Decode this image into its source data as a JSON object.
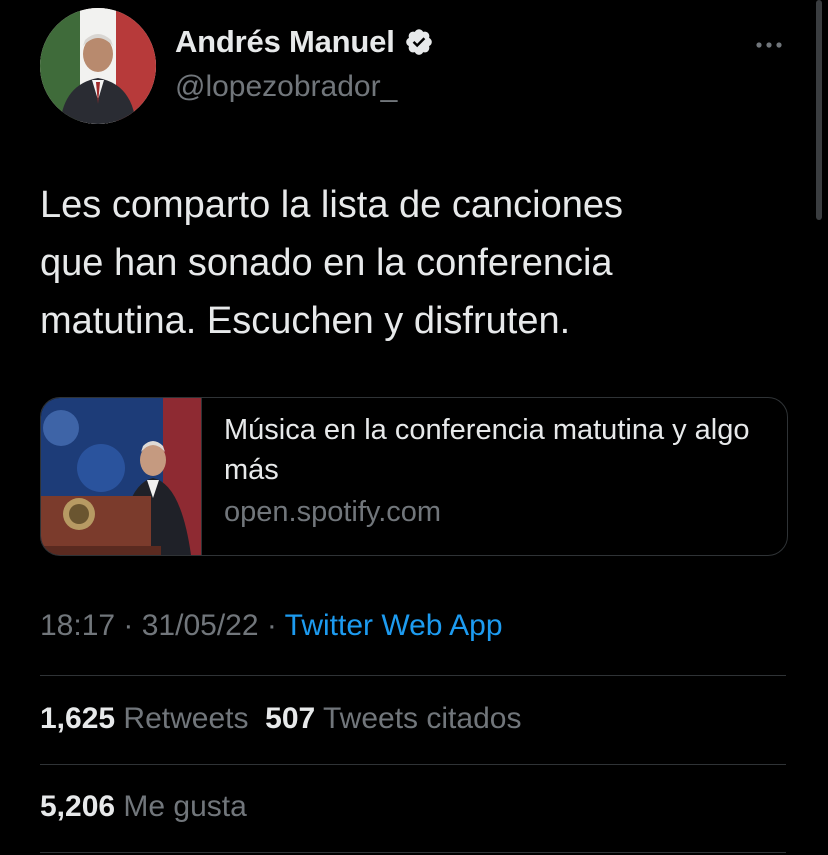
{
  "author": {
    "display_name": "Andrés Manuel",
    "handle": "@lopezobrador_",
    "verified": true
  },
  "tweet": {
    "text": "Les comparto la lista de canciones\nque han sonado en la conferencia\nmatutina. Escuchen y disfruten."
  },
  "link_card": {
    "title": "Música en la conferencia matutina y algo más",
    "domain": "open.spotify.com"
  },
  "meta": {
    "time": "18:17",
    "separator": " · ",
    "date": "31/05/22",
    "source": "Twitter Web App"
  },
  "stats": {
    "retweets_count": "1,625",
    "retweets_label": "Retweets",
    "quotes_count": "507",
    "quotes_label": "Tweets citados",
    "likes_count": "5,206",
    "likes_label": "Me gusta"
  },
  "colors": {
    "background": "#000000",
    "text_primary": "#e7e9ea",
    "text_secondary": "#71767b",
    "link": "#1d9bf0",
    "divider": "#2f3336"
  },
  "icons": {
    "verified": "verified-badge-icon",
    "more": "more-horizontal-icon"
  }
}
